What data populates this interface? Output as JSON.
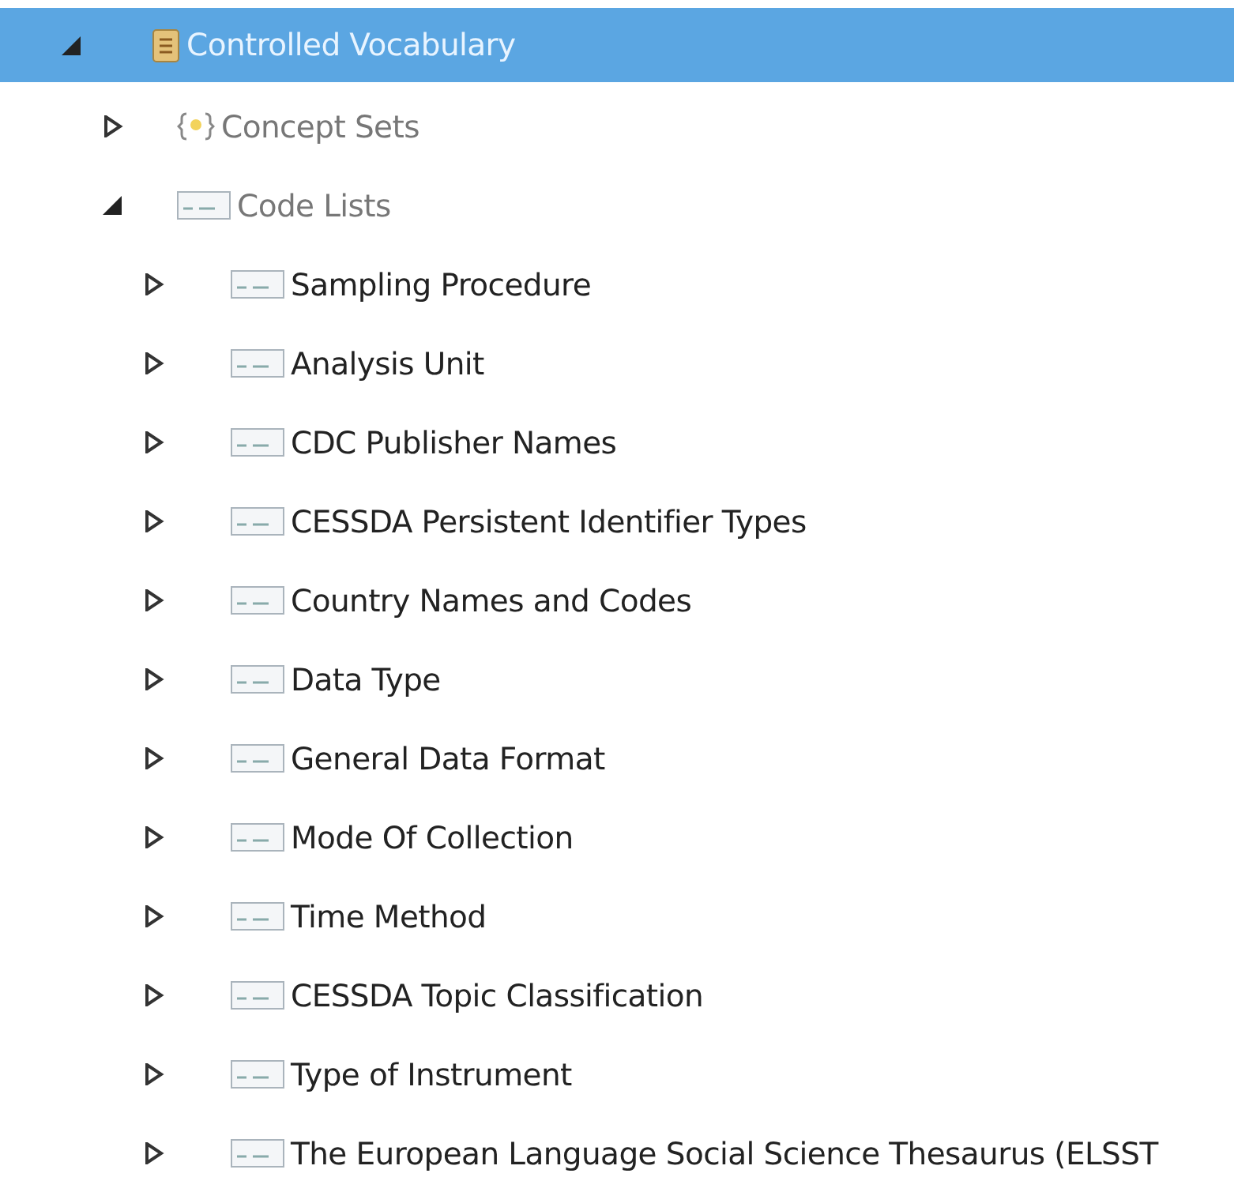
{
  "tree": [
    {
      "label": "Controlled Vocabulary",
      "kind": "vocabulary",
      "expanded": true,
      "selected": true,
      "children": [
        {
          "label": "Concept Sets",
          "kind": "concept-set",
          "expanded": false,
          "selected": false
        },
        {
          "label": "Code Lists",
          "kind": "code-list-group",
          "expanded": true,
          "selected": false,
          "children": [
            {
              "label": "Sampling Procedure",
              "kind": "code-list",
              "expanded": false,
              "selected": false
            },
            {
              "label": "Analysis Unit",
              "kind": "code-list",
              "expanded": false,
              "selected": false
            },
            {
              "label": "CDC Publisher Names",
              "kind": "code-list",
              "expanded": false,
              "selected": false
            },
            {
              "label": "CESSDA Persistent Identifier Types",
              "kind": "code-list",
              "expanded": false,
              "selected": false
            },
            {
              "label": "Country Names and Codes",
              "kind": "code-list",
              "expanded": false,
              "selected": false
            },
            {
              "label": "Data Type",
              "kind": "code-list",
              "expanded": false,
              "selected": false
            },
            {
              "label": "General Data Format",
              "kind": "code-list",
              "expanded": false,
              "selected": false
            },
            {
              "label": "Mode Of Collection",
              "kind": "code-list",
              "expanded": false,
              "selected": false
            },
            {
              "label": "Time Method",
              "kind": "code-list",
              "expanded": false,
              "selected": false
            },
            {
              "label": "CESSDA Topic Classification",
              "kind": "code-list",
              "expanded": false,
              "selected": false
            },
            {
              "label": "Type of Instrument",
              "kind": "code-list",
              "expanded": false,
              "selected": false
            },
            {
              "label": "The European Language Social Science Thesaurus (ELSST",
              "kind": "code-list",
              "expanded": false,
              "selected": false
            }
          ]
        }
      ]
    }
  ]
}
